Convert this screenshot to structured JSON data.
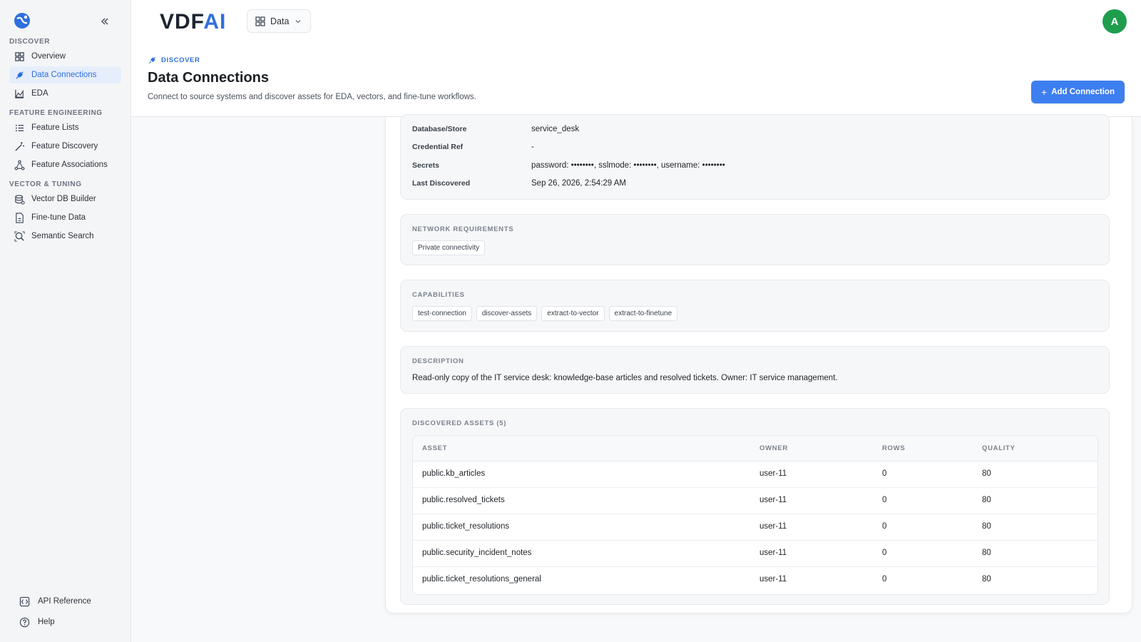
{
  "sidebar": {
    "sections": [
      {
        "label": "DISCOVER"
      },
      {
        "label": "FEATURE ENGINEERING"
      },
      {
        "label": "VECTOR & TUNING"
      }
    ],
    "items": [
      {
        "label": "Overview",
        "icon": "grid-icon"
      },
      {
        "label": "Data Connections",
        "icon": "plug-icon",
        "active": true
      },
      {
        "label": "EDA",
        "icon": "area-chart-icon"
      },
      {
        "label": "Feature Lists",
        "icon": "list-icon"
      },
      {
        "label": "Feature Discovery",
        "icon": "wand-icon"
      },
      {
        "label": "Feature Associations",
        "icon": "network-icon"
      },
      {
        "label": "Vector DB Builder",
        "icon": "database-icon"
      },
      {
        "label": "Fine-tune Data",
        "icon": "file-icon"
      },
      {
        "label": "Semantic Search",
        "icon": "search-icon"
      }
    ],
    "bottom": [
      {
        "label": "API Reference",
        "icon": "code-icon"
      },
      {
        "label": "Help",
        "icon": "help-icon"
      }
    ]
  },
  "header": {
    "brand_main": "VDF",
    "brand_accent": "AI",
    "workspace": "Data",
    "avatar": "A",
    "breadcrumb": "DISCOVER",
    "title": "Data Connections",
    "subtitle": "Connect to source systems and discover assets for EDA, vectors, and fine-tune workflows.",
    "add_button": "Add Connection"
  },
  "details": [
    {
      "key": "Database/Store",
      "value": "service_desk"
    },
    {
      "key": "Credential Ref",
      "value": "-"
    },
    {
      "key": "Secrets",
      "value": "password: ••••••••, sslmode: ••••••••, username: ••••••••"
    },
    {
      "key": "Last Discovered",
      "value": "Sep 26, 2026, 2:54:29 AM"
    }
  ],
  "network": {
    "label": "NETWORK REQUIREMENTS",
    "chips": [
      "Private connectivity"
    ]
  },
  "capabilities": {
    "label": "CAPABILITIES",
    "chips": [
      "test-connection",
      "discover-assets",
      "extract-to-vector",
      "extract-to-finetune"
    ]
  },
  "description": {
    "label": "DESCRIPTION",
    "text": "Read-only copy of the IT service desk: knowledge-base articles and resolved tickets. Owner: IT service management."
  },
  "assets": {
    "label": "DISCOVERED ASSETS (5)",
    "columns": [
      "ASSET",
      "OWNER",
      "ROWS",
      "QUALITY"
    ],
    "rows": [
      {
        "asset": "public.kb_articles",
        "owner": "user-11",
        "rows": "0",
        "quality": "80"
      },
      {
        "asset": "public.resolved_tickets",
        "owner": "user-11",
        "rows": "0",
        "quality": "80"
      },
      {
        "asset": "public.ticket_resolutions",
        "owner": "user-11",
        "rows": "0",
        "quality": "80"
      },
      {
        "asset": "public.security_incident_notes",
        "owner": "user-11",
        "rows": "0",
        "quality": "80"
      },
      {
        "asset": "public.ticket_resolutions_general",
        "owner": "user-11",
        "rows": "0",
        "quality": "80"
      }
    ]
  },
  "colors": {
    "accent": "#3d7ef0",
    "avatar": "#1f9d4d",
    "active_bg": "#e6eefb"
  }
}
